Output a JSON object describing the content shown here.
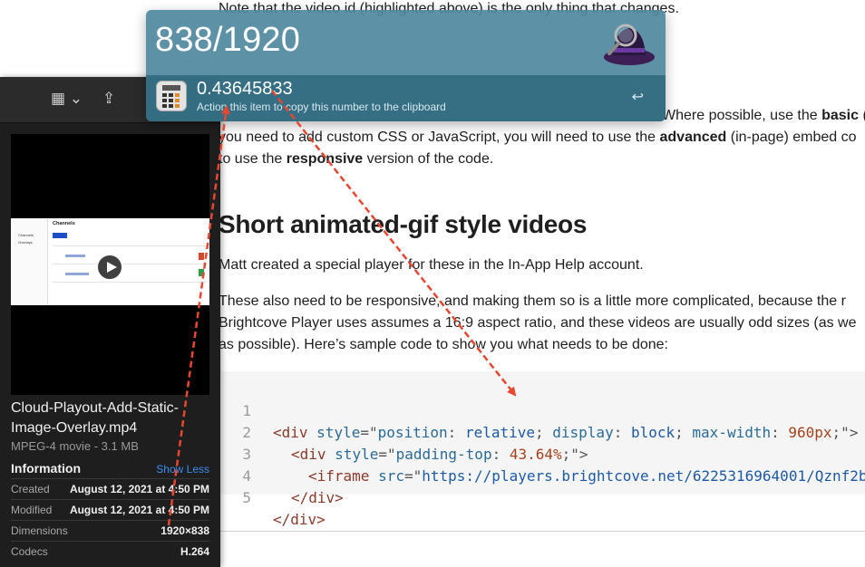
{
  "document": {
    "top_line": "Note that the video id (highlighted above) is the only thing that changes.",
    "para1": {
      "line1_pre": "Where possible, use the ",
      "line1_bold": "basic",
      "line1_post": " (i",
      "line2_pre": "you need to add custom CSS or JavaScript, you will need to use the ",
      "line2_bold": "advanced",
      "line2_post": " (in-page) embed co",
      "line3_pre": "to use the ",
      "line3_bold": "responsive",
      "line3_post": " version of the code."
    },
    "heading": "Short animated-gif style videos",
    "para2": "Matt created a special player for these in the In-App Help account.",
    "para3": {
      "line1": "These also need to be responsive, and making them so is a little more complicated, because the r",
      "line2": "Brightcove Player uses assumes a 16:9 aspect ratio, and these videos are usually odd sizes (as we",
      "line3": "as possible). Here’s sample code to show you what needs to be done:"
    },
    "code": {
      "line_numbers": [
        "1",
        "2",
        "3",
        "4",
        "5"
      ],
      "l1": {
        "open": "<div ",
        "attr": "style",
        "eq": "=\"",
        "p1": "position",
        "c1": ": ",
        "v1": "relative",
        "s1": "; ",
        "p2": "display",
        "c2": ": ",
        "v2": "block",
        "s2": "; ",
        "p3": "max-width",
        "c3": ": ",
        "v3": "960",
        "u3": "px",
        "s3": ";\">"
      },
      "l2": {
        "open": "<div ",
        "attr": "style",
        "eq": "=\"",
        "p1": "padding-top",
        "c1": ": ",
        "v1": "43.64",
        "u1": "%",
        "s1": ";\">"
      },
      "l3": {
        "open": "<iframe ",
        "attr": "src",
        "eq": "=\"",
        "url": "https://players.brightcove.net/6225316964001/Qznf2b"
      },
      "l4": "</div>",
      "l5": "</div>"
    }
  },
  "finder": {
    "file_name": "Cloud-Playout-Add-Static-Image-Overlay.mp4",
    "file_kind": "MPEG-4 movie - 3.1 MB",
    "info_heading": "Information",
    "show_less": "Show Less",
    "rows": [
      {
        "label": "Created",
        "value": "August 12, 2021 at 4:50 PM"
      },
      {
        "label": "Modified",
        "value": "August 12, 2021 at 4:50 PM"
      },
      {
        "label": "Dimensions",
        "value": "1920×838"
      },
      {
        "label": "Codecs",
        "value": "H.264"
      }
    ],
    "thumbnail": {
      "title": "Channels",
      "sidebar": [
        "Channels",
        "Overlays"
      ]
    }
  },
  "alfred": {
    "query": "838/1920",
    "result_title": "0.43645833",
    "result_subtitle": "Action this item to copy this number to the clipboard",
    "return_glyph": "↩"
  },
  "colors": {
    "alfred_bg": "#4e889e",
    "arrow": "#e8472f",
    "finder_bg": "#1e1e1e",
    "link_blue": "#3b8ef0"
  }
}
